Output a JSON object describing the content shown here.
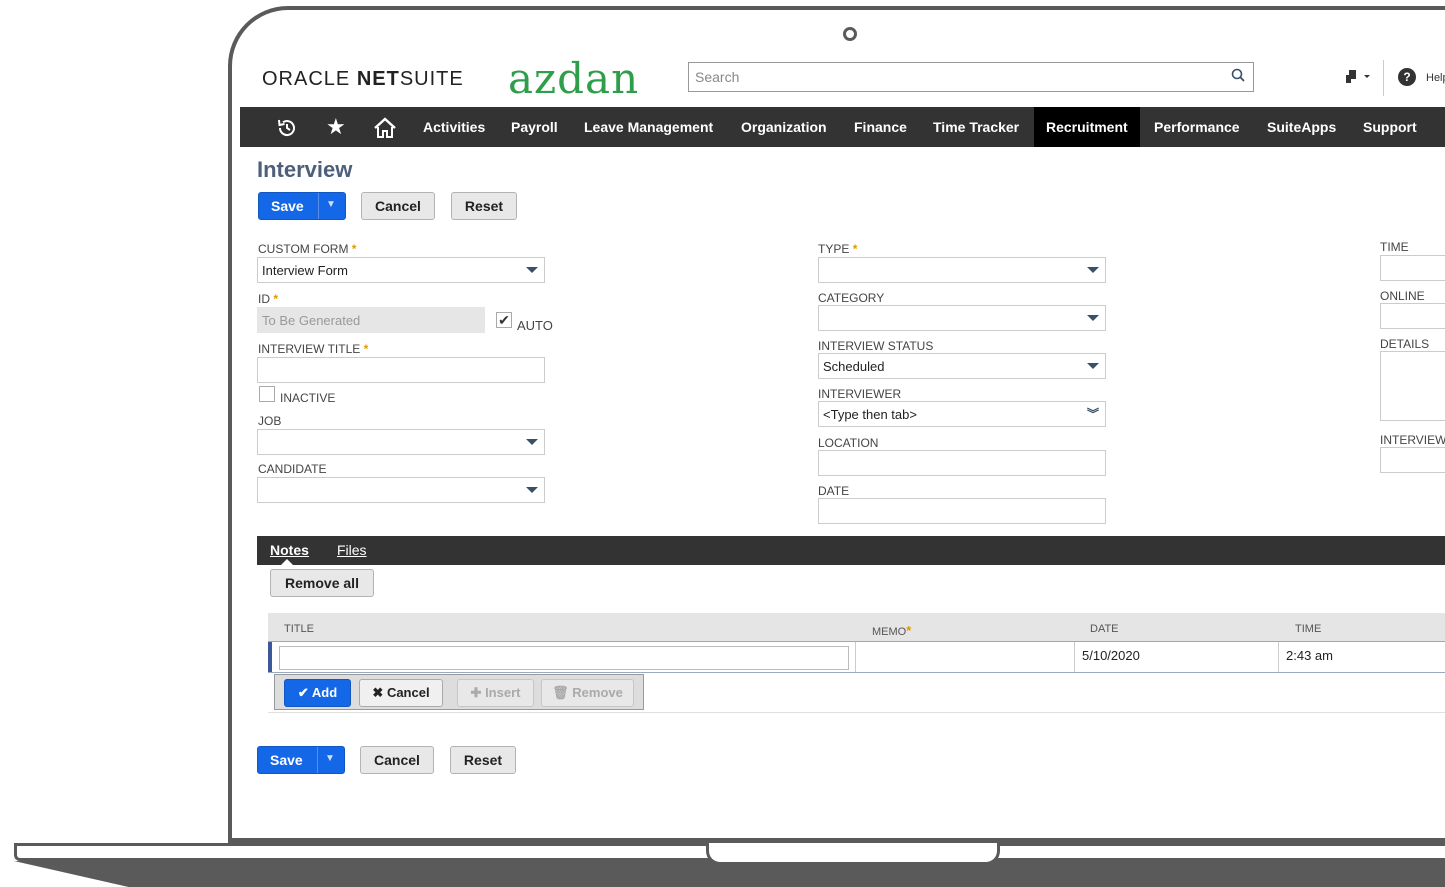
{
  "header": {
    "logo_oracle_a": "ORACLE",
    "logo_oracle_b": "NET",
    "logo_oracle_c": "SUITE",
    "logo_brand": "azdan",
    "search_placeholder": "Search",
    "help_label": "Help"
  },
  "nav": {
    "items": [
      "Activities",
      "Payroll",
      "Leave Management",
      "Organization",
      "Finance",
      "Time Tracker",
      "Recruitment",
      "Performance",
      "SuiteApps",
      "Support"
    ],
    "active": "Recruitment"
  },
  "page": {
    "title": "Interview",
    "save_label": "Save",
    "cancel_label": "Cancel",
    "reset_label": "Reset"
  },
  "form": {
    "custom_form_label": "CUSTOM FORM",
    "custom_form_value": "Interview Form",
    "id_label": "ID",
    "id_value": "To Be Generated",
    "auto_label": "AUTO",
    "auto_checked": true,
    "interview_title_label": "INTERVIEW TITLE",
    "interview_title_value": "",
    "inactive_label": "INACTIVE",
    "inactive_checked": false,
    "job_label": "JOB",
    "candidate_label": "CANDIDATE",
    "type_label": "TYPE",
    "category_label": "CATEGORY",
    "interview_status_label": "INTERVIEW STATUS",
    "interview_status_value": "Scheduled",
    "interviewer_label": "INTERVIEWER",
    "interviewer_value": "<Type then tab>",
    "location_label": "LOCATION",
    "date_label": "DATE",
    "time_label": "TIME",
    "online_url_label": "ONLINE UR",
    "details_label": "DETAILS",
    "interview_label_partial": "INTERVIEW"
  },
  "subtabs": {
    "notes": "Notes",
    "files": "Files",
    "remove_all": "Remove all"
  },
  "notes_grid": {
    "columns": [
      "TITLE",
      "MEMO",
      "DATE",
      "TIME"
    ],
    "row": {
      "title": "",
      "memo": "",
      "date": "5/10/2020",
      "time": "2:43 am"
    },
    "add_label": "Add",
    "cancel_label": "Cancel",
    "insert_label": "Insert",
    "remove_label": "Remove"
  },
  "colors": {
    "nav_bg": "#333333",
    "primary_button": "#1467e6",
    "brand_green": "#2f9e4a",
    "title_color": "#4d5f79",
    "required": "#e09a00"
  }
}
